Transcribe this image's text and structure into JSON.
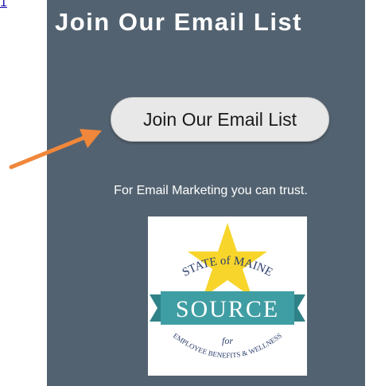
{
  "page": {
    "corner_link": "1"
  },
  "signup": {
    "title": "Join Our Email List",
    "button_label": "Join Our Email List",
    "tagline": "For Email Marketing you can trust."
  },
  "logo": {
    "top_text": "STATE of MAINE",
    "banner_text": "SOURCE",
    "for_text": "for",
    "bottom_text": "EMPLOYEE BENEFITS & WELLNESS"
  },
  "colors": {
    "panel_bg": "#536270",
    "arrow": "#f0873a",
    "star": "#f7d52a",
    "banner": "#3f9ea3"
  }
}
